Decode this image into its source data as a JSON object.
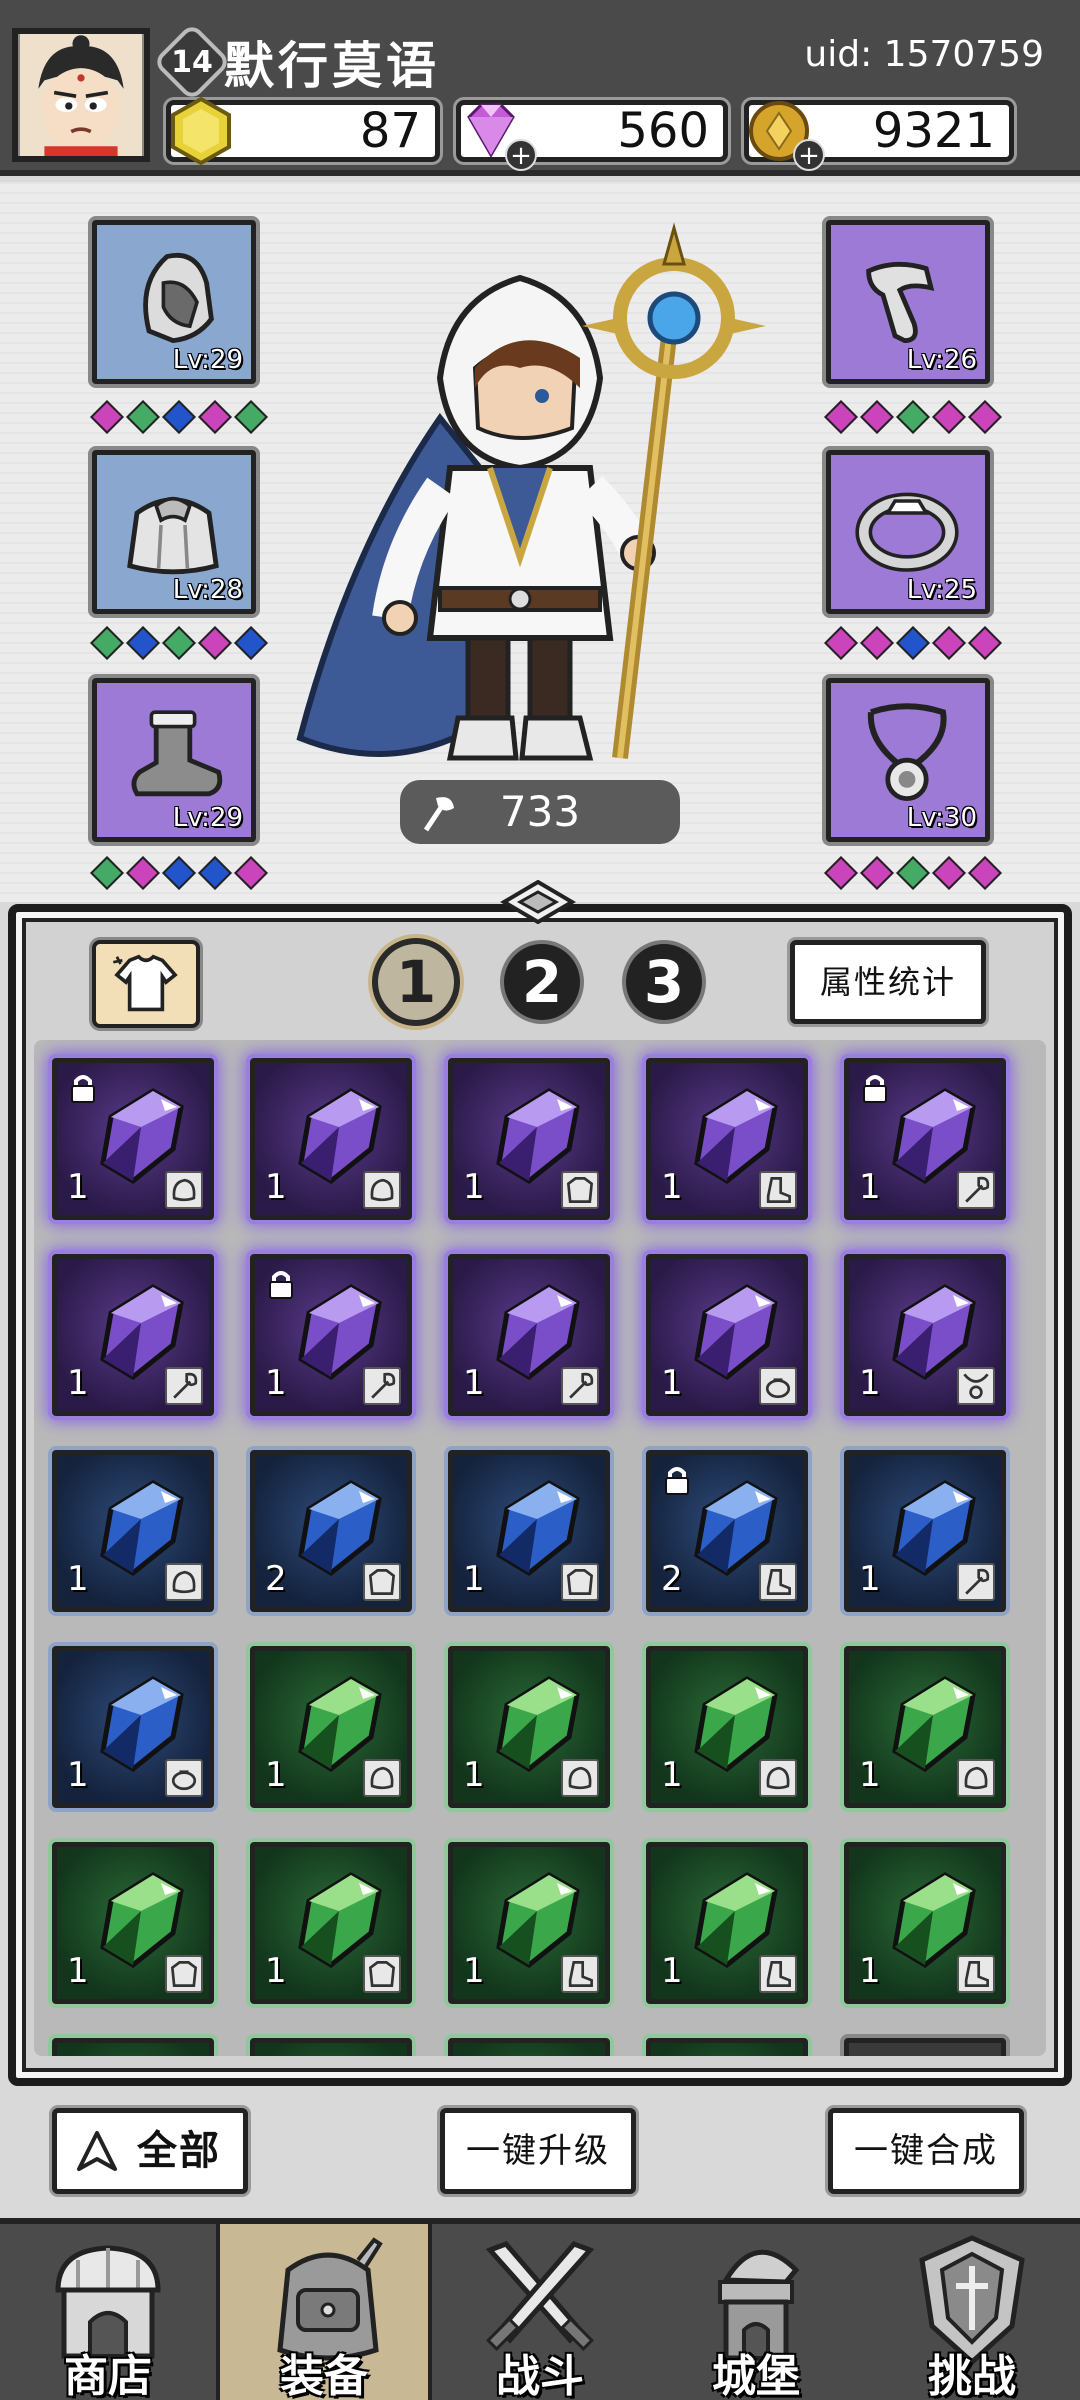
{
  "player": {
    "name": "默行莫语",
    "level": "14",
    "uid": "uid: 1570759"
  },
  "resources": {
    "gold": "87",
    "gems": "560",
    "coins": "9321"
  },
  "hero": {
    "power": "733"
  },
  "left_equipment": [
    {
      "slot": "helmet",
      "level": "Lv:29",
      "rarity": "blue",
      "gems": [
        "p",
        "g",
        "b",
        "p",
        "g"
      ]
    },
    {
      "slot": "armor",
      "level": "Lv:28",
      "rarity": "blue",
      "gems": [
        "g",
        "b",
        "g",
        "p",
        "b"
      ]
    },
    {
      "slot": "boots",
      "level": "Lv:29",
      "rarity": "purple",
      "gems": [
        "g",
        "p",
        "b",
        "b",
        "p"
      ]
    }
  ],
  "right_equipment": [
    {
      "slot": "gloves",
      "level": "Lv:26",
      "rarity": "purple",
      "gems": [
        "p",
        "p",
        "g",
        "p",
        "p"
      ]
    },
    {
      "slot": "ring",
      "level": "Lv:25",
      "rarity": "purple",
      "gems": [
        "p",
        "p",
        "b",
        "p",
        "p"
      ]
    },
    {
      "slot": "necklace",
      "level": "Lv:30",
      "rarity": "purple",
      "gems": [
        "p",
        "p",
        "g",
        "p",
        "p"
      ]
    }
  ],
  "tabs": [
    "1",
    "2",
    "3"
  ],
  "active_tab": "1",
  "stats_button": "属性统计",
  "inventory": [
    [
      {
        "rarity": "purple",
        "qty": "1",
        "type": "helmet",
        "locked": true
      },
      {
        "rarity": "purple",
        "qty": "1",
        "type": "helmet",
        "locked": false
      },
      {
        "rarity": "purple",
        "qty": "1",
        "type": "armor",
        "locked": false
      },
      {
        "rarity": "purple",
        "qty": "1",
        "type": "boots",
        "locked": false
      },
      {
        "rarity": "purple",
        "qty": "1",
        "type": "weapon",
        "locked": true
      }
    ],
    [
      {
        "rarity": "purple",
        "qty": "1",
        "type": "weapon",
        "locked": false
      },
      {
        "rarity": "purple",
        "qty": "1",
        "type": "weapon",
        "locked": true
      },
      {
        "rarity": "purple",
        "qty": "1",
        "type": "weapon",
        "locked": false
      },
      {
        "rarity": "purple",
        "qty": "1",
        "type": "ring",
        "locked": false
      },
      {
        "rarity": "purple",
        "qty": "1",
        "type": "necklace",
        "locked": false
      }
    ],
    [
      {
        "rarity": "blue",
        "qty": "1",
        "type": "helmet",
        "locked": false
      },
      {
        "rarity": "blue",
        "qty": "2",
        "type": "armor",
        "locked": false
      },
      {
        "rarity": "blue",
        "qty": "1",
        "type": "armor",
        "locked": false
      },
      {
        "rarity": "blue",
        "qty": "2",
        "type": "boots",
        "locked": true
      },
      {
        "rarity": "blue",
        "qty": "1",
        "type": "weapon",
        "locked": false
      }
    ],
    [
      {
        "rarity": "blue",
        "qty": "1",
        "type": "ring",
        "locked": false
      },
      {
        "rarity": "green",
        "qty": "1",
        "type": "helmet",
        "locked": false
      },
      {
        "rarity": "green",
        "qty": "1",
        "type": "helmet",
        "locked": false
      },
      {
        "rarity": "green",
        "qty": "1",
        "type": "helmet",
        "locked": false
      },
      {
        "rarity": "green",
        "qty": "1",
        "type": "helmet",
        "locked": false
      }
    ],
    [
      {
        "rarity": "green",
        "qty": "1",
        "type": "armor",
        "locked": false
      },
      {
        "rarity": "green",
        "qty": "1",
        "type": "armor",
        "locked": false
      },
      {
        "rarity": "green",
        "qty": "1",
        "type": "boots",
        "locked": false
      },
      {
        "rarity": "green",
        "qty": "1",
        "type": "boots",
        "locked": false
      },
      {
        "rarity": "green",
        "qty": "1",
        "type": "boots",
        "locked": false
      }
    ],
    [
      {
        "rarity": "green",
        "qty": "",
        "type": "",
        "locked": false
      },
      {
        "rarity": "green",
        "qty": "",
        "type": "",
        "locked": false
      },
      {
        "rarity": "green",
        "qty": "",
        "type": "",
        "locked": false
      },
      {
        "rarity": "green",
        "qty": "",
        "type": "",
        "locked": false
      },
      {
        "rarity": "gray",
        "qty": "",
        "type": "",
        "locked": false
      }
    ]
  ],
  "actions": {
    "filter_all": "全部",
    "upgrade_all": "一键升级",
    "merge_all": "一键合成"
  },
  "nav": [
    {
      "label": "商店",
      "icon": "shop-icon"
    },
    {
      "label": "装备",
      "icon": "backpack-icon"
    },
    {
      "label": "战斗",
      "icon": "swords-icon"
    },
    {
      "label": "城堡",
      "icon": "castle-icon"
    },
    {
      "label": "挑战",
      "icon": "challenge-icon"
    }
  ],
  "active_nav": "装备",
  "colors": {
    "purple": "#9c7ad6",
    "blue": "#8aa7cf",
    "green": "#44aa66",
    "gem_pink": "#cc44bb",
    "gem_green": "#44aa66",
    "gem_blue": "#2255cc"
  }
}
